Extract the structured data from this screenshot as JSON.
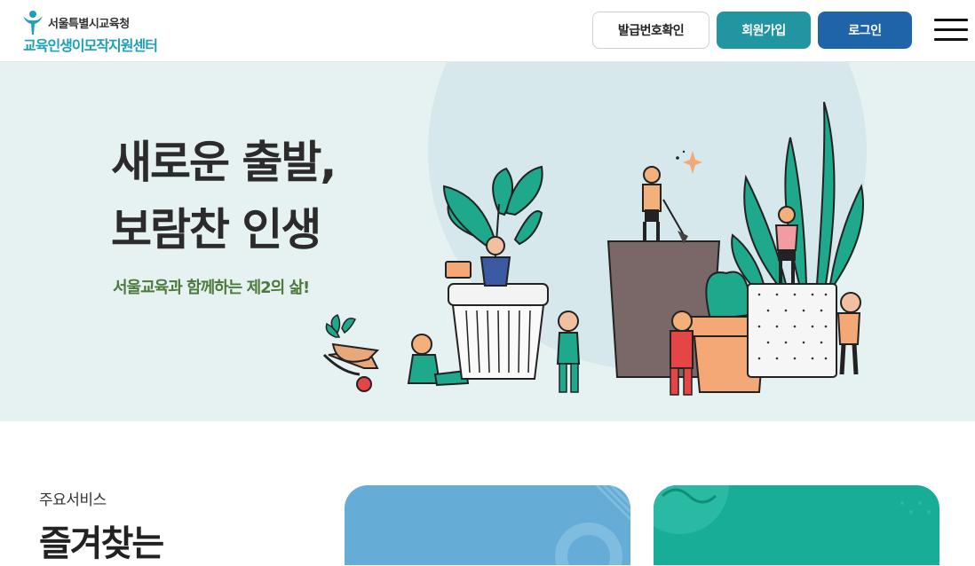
{
  "header": {
    "logo_top": "서울특별시교육청",
    "logo_bottom": "교육인생이모작지원센터",
    "btn_issue": "발급번호확인",
    "btn_join": "회원가입",
    "btn_login": "로그인"
  },
  "hero": {
    "title_line1": "새로운 출발,",
    "title_line2": "보람찬 인생",
    "subtitle": "서울교육과 함께하는 제2의 삶!"
  },
  "services": {
    "label": "주요서비스",
    "heading": "즐겨찾는"
  },
  "colors": {
    "brand_teal": "#2196a2",
    "brand_blue": "#1f63a8",
    "hero_bg": "#e6f1f2",
    "card_blue": "#65acd6",
    "card_green": "#17ad96"
  }
}
